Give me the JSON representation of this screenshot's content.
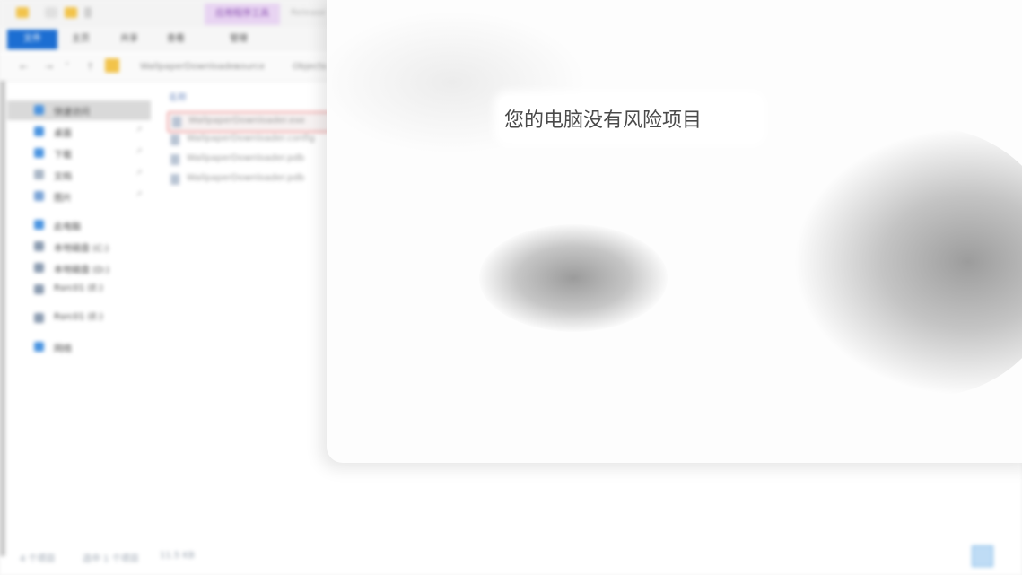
{
  "window": {
    "title": "",
    "context_tab": "应用程序工具",
    "title_suffix": "Release"
  },
  "ribbon": {
    "tabs": [
      "文件",
      "主页",
      "共享",
      "查看",
      "管理"
    ]
  },
  "address": {
    "crumbs": [
      "WallpaperDownloader",
      "source",
      "Objects"
    ]
  },
  "nav_pane": {
    "items": [
      {
        "label": "快速访问",
        "icon": "star-icon",
        "color": "#4b94e0",
        "selected": true
      },
      {
        "label": "桌面",
        "icon": "desktop-icon",
        "color": "#4b94e0",
        "pinned": true
      },
      {
        "label": "下载",
        "icon": "download-icon",
        "color": "#4b94e0",
        "pinned": true
      },
      {
        "label": "文档",
        "icon": "document-icon",
        "color": "#a9b6c6",
        "pinned": true
      },
      {
        "label": "图片",
        "icon": "picture-icon",
        "color": "#7aa3d6",
        "pinned": true
      },
      {
        "label": "此电脑",
        "icon": "computer-icon",
        "color": "#4b94e0"
      },
      {
        "label": "本地磁盘 (C:)",
        "icon": "drive-icon",
        "color": "#8b9bb0"
      },
      {
        "label": "本地磁盘 (D:)",
        "icon": "drive-icon",
        "color": "#8b9bb0"
      },
      {
        "label": "Rsrc01 (E:)",
        "icon": "drive-icon",
        "color": "#8b9bb0"
      },
      {
        "label": "Rsrc01 (E:)",
        "icon": "drive-icon",
        "color": "#8b9bb0"
      },
      {
        "label": "网络",
        "icon": "network-icon",
        "color": "#4b94e0"
      }
    ]
  },
  "file_list": {
    "column_header": "名称",
    "files": [
      {
        "name": "WallpaperDownloader.exe",
        "icon": "exe-icon",
        "selected": true
      },
      {
        "name": "WallpaperDownloader.config",
        "icon": "config-icon"
      },
      {
        "name": "WallpaperDownloader.pdb",
        "icon": "pdb-icon"
      },
      {
        "name": "WallpaperDownloader.pdb",
        "icon": "pdb-icon"
      }
    ]
  },
  "status_bar": {
    "item_count": "4 个项目",
    "selected_info": "选中 1 个项目",
    "size": "11.5 KB"
  },
  "dialog": {
    "message": "您的电脑没有风险项目"
  }
}
